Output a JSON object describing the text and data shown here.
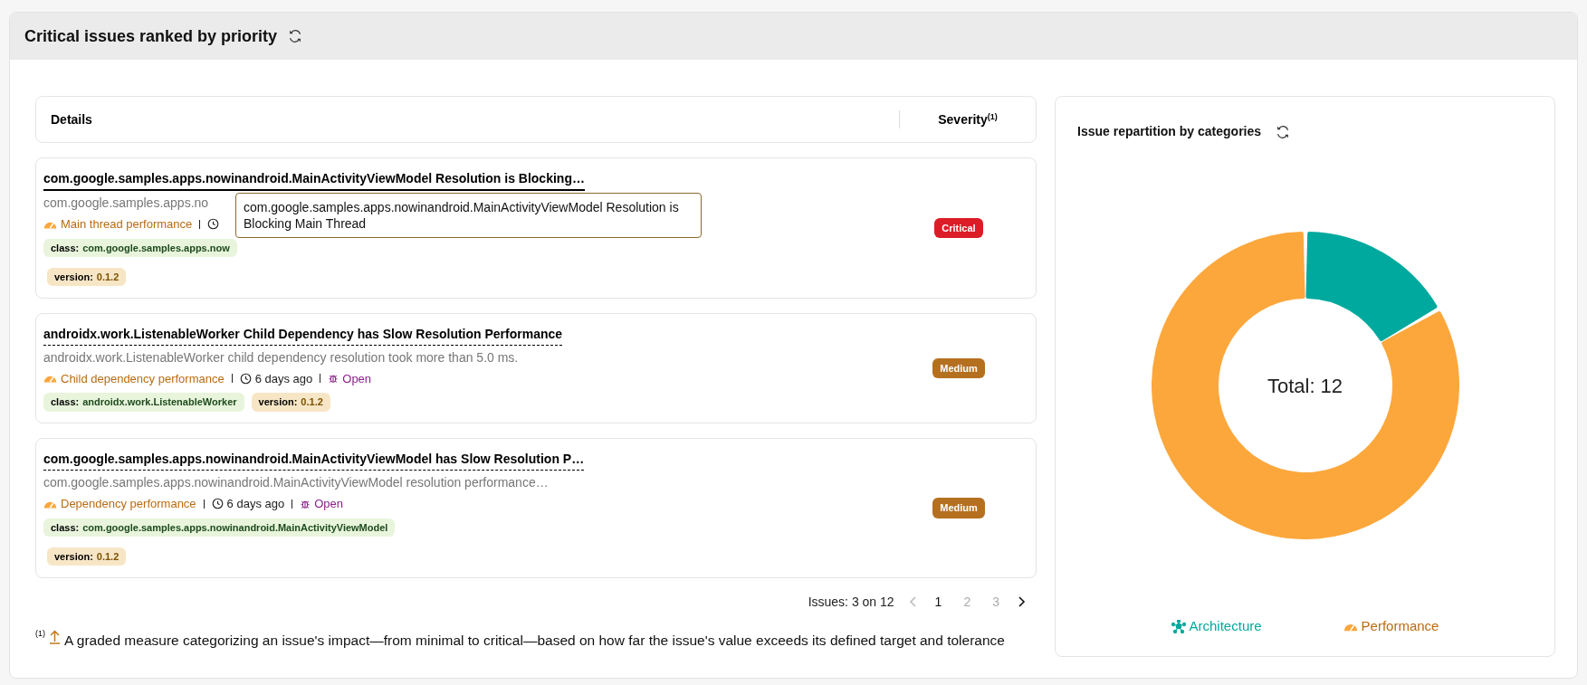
{
  "panel": {
    "title": "Critical issues ranked by priority"
  },
  "table": {
    "columns": [
      {
        "label": "Details"
      },
      {
        "label": "Severity",
        "note": "(1)"
      }
    ],
    "rows": [
      {
        "title": "com.google.samples.apps.nowinandroid.MainActivityViewModel Resolution is Blocking…",
        "hovered": true,
        "description": "com.google.samples.apps.no",
        "category": "Main thread performance",
        "tags": [
          {
            "kind": "class",
            "key": "class:",
            "value": "com.google.samples.apps.now"
          },
          {
            "kind": "version",
            "key": "version:",
            "value": "0.1.2"
          }
        ],
        "tags_wrap": true,
        "severity": {
          "label": "Critical",
          "color": "#dc1c26"
        },
        "tooltip": "com.google.samples.apps.nowinandroid.MainActivityViewModel Resolution is Blocking Main Thread"
      },
      {
        "title": "androidx.work.ListenableWorker Child Dependency has Slow Resolution Performance",
        "hovered": false,
        "description": "androidx.work.ListenableWorker child dependency resolution took more than 5.0 ms.",
        "category": "Child dependency performance",
        "time": "6 days ago",
        "status": "Open",
        "tags": [
          {
            "kind": "class",
            "key": "class:",
            "value": "androidx.work.ListenableWorker"
          },
          {
            "kind": "version",
            "key": "version:",
            "value": "0.1.2"
          }
        ],
        "tags_wrap": false,
        "severity": {
          "label": "Medium",
          "color": "#b5701f"
        }
      },
      {
        "title": "com.google.samples.apps.nowinandroid.MainActivityViewModel has Slow Resolution P…",
        "hovered": false,
        "description": "com.google.samples.apps.nowinandroid.MainActivityViewModel resolution performance…",
        "category": "Dependency performance",
        "time": "6 days ago",
        "status": "Open",
        "tags": [
          {
            "kind": "class",
            "key": "class:",
            "value": "com.google.samples.apps.nowinandroid.MainActivityViewModel"
          },
          {
            "kind": "version",
            "key": "version:",
            "value": "0.1.2"
          }
        ],
        "tags_wrap": true,
        "severity": {
          "label": "Medium",
          "color": "#b5701f"
        }
      }
    ]
  },
  "pagination": {
    "summary": "Issues: 3 on 12",
    "prev_disabled": true,
    "next_disabled": false,
    "pages": [
      {
        "label": "1",
        "selected": true
      },
      {
        "label": "2",
        "selected": false
      },
      {
        "label": "3",
        "selected": false
      }
    ]
  },
  "footnote": {
    "mark": "(1)",
    "text": "A graded measure categorizing an issue's impact—from minimal to critical—based on how far the issue's value exceeds its defined target and tolerance"
  },
  "chart_panel": {
    "title": "Issue repartition by categories",
    "center_label": "Total: 12",
    "chart_data": {
      "type": "donut",
      "categories": [
        "Architecture",
        "Performance"
      ],
      "values": [
        16.7,
        83.3
      ]
    },
    "legend": [
      {
        "kind": "architecture",
        "color": "#00a99d"
      },
      {
        "kind": "performance",
        "color": "#fca73c"
      }
    ]
  }
}
